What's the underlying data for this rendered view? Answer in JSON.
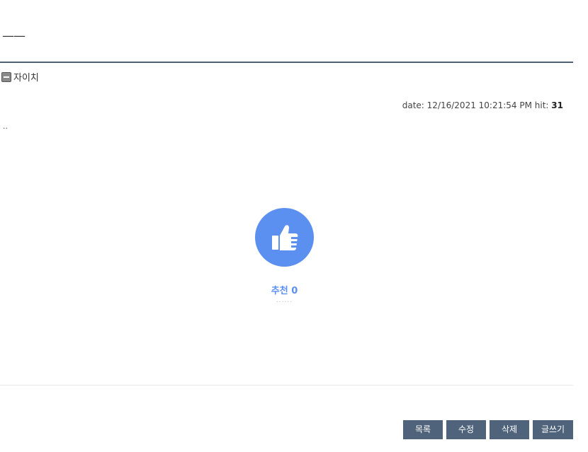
{
  "post": {
    "title": "——",
    "author": "자이치",
    "date_label": "date:",
    "date": "12/16/2021 10:21:54 PM",
    "hit_label": "hit:",
    "hit": "31",
    "content": ".."
  },
  "like": {
    "label": "추천 0",
    "sub": "......",
    "icon": "thumbs-up-icon",
    "color": "#5b8ff0"
  },
  "buttons": {
    "list": "목록",
    "edit": "수정",
    "delete": "삭제",
    "write": "글쓰기"
  },
  "colors": {
    "rule": "#4d6078",
    "button_bg": "#4f637a"
  }
}
